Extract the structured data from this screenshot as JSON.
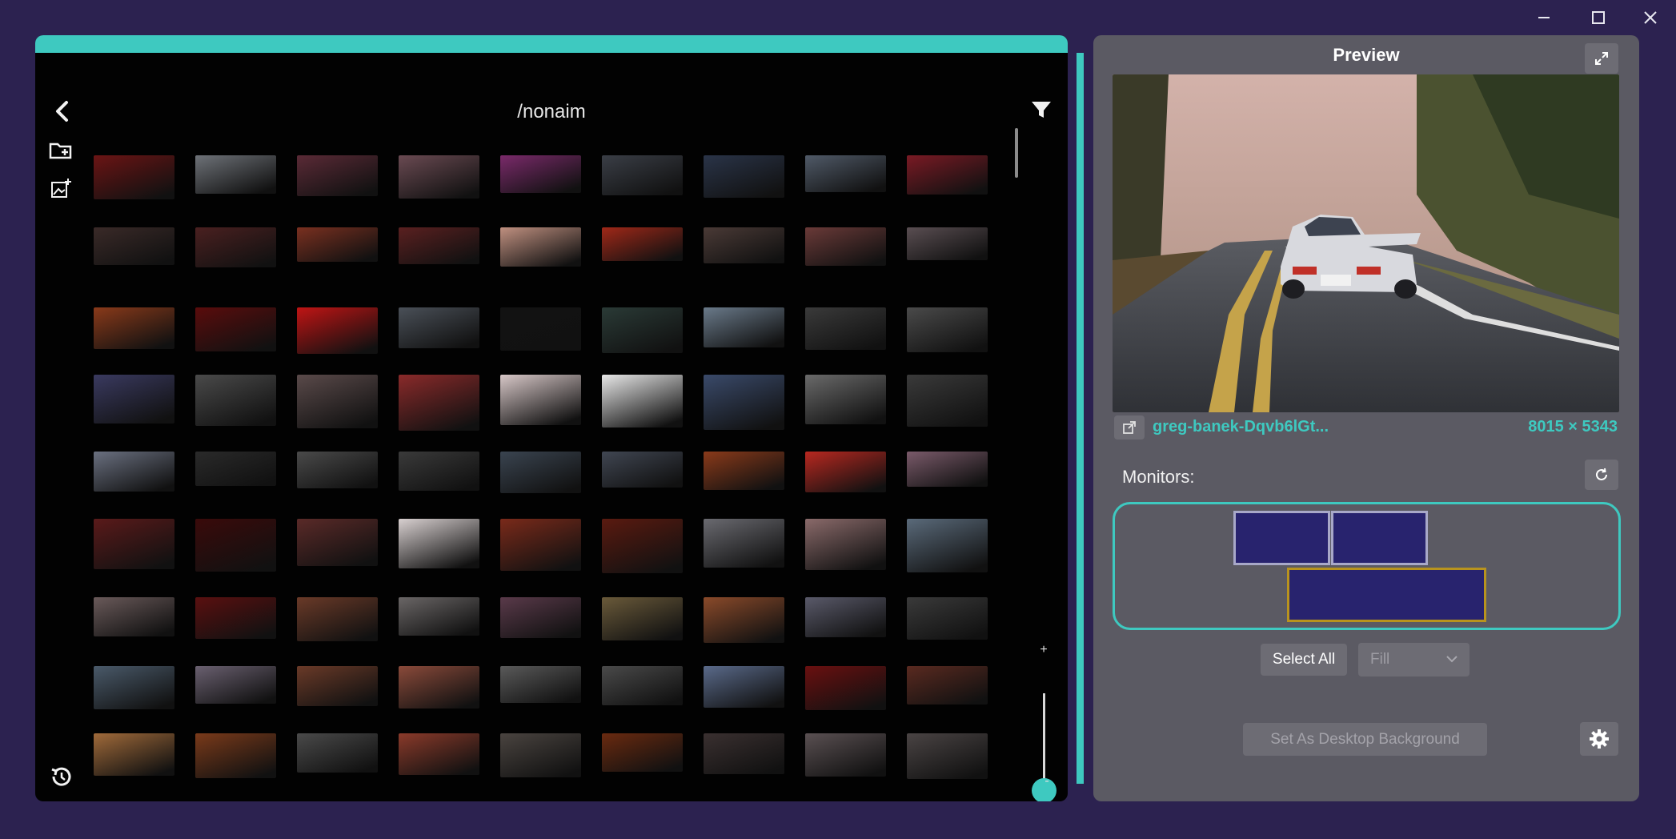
{
  "window": {
    "minimize_icon": "minimize-icon",
    "maximize_icon": "maximize-icon",
    "close_icon": "close-icon"
  },
  "browser": {
    "path": "/nonaim",
    "back_icon": "chevron-left-icon",
    "filter_icon": "filter-icon",
    "add_folder_icon": "folder-plus-icon",
    "add_image_icon": "image-plus-icon",
    "history_icon": "history-icon",
    "zoom_plus": "+",
    "zoom_minus": "-",
    "zoom_level": 0.15,
    "accent_color": "#3ec9c0"
  },
  "thumbnails": [
    [
      "#6b1414",
      "#6e7278",
      "#5a2a36",
      "#6a4a52",
      "#7a2a6a",
      "#3a3e46",
      "#2a3448",
      "#505a68",
      "#7a1a24"
    ],
    [
      "#3a2a28",
      "#4a2020",
      "#7a3020",
      "#5a2020",
      "#c09080",
      "#a02818",
      "#4a3a36",
      "#6a3a38",
      "#5a4e52"
    ],
    [
      "#8a3a1a",
      "#5a0c0c",
      "#c01414",
      "#4a5058",
      "#121212",
      "#2a3a36",
      "#6a7a8a",
      "#3a3a3a",
      "#4a4a4a"
    ],
    [
      "#3a3a60",
      "#4a4a4a",
      "#5a4a4a",
      "#8a2a2a",
      "#d8c8c8",
      "#e8e8e8",
      "#3a4a6a",
      "#6a6a6a",
      "#3a3a3a"
    ],
    [
      "#6a7080",
      "#2a2a2a",
      "#4a4a4a",
      "#3a3a3a",
      "#3a4450",
      "#404652",
      "#8a3a1a",
      "#b82820",
      "#7a5a6a"
    ],
    [
      "#5a1a1a",
      "#3a0a0a",
      "#5a2a28",
      "#d8d0d0",
      "#7a2a1a",
      "#5a1a10",
      "#6a6a70",
      "#8a6a6a",
      "#5a6a7a"
    ],
    [
      "#6a5a5a",
      "#5a1010",
      "#6a3a28",
      "#6a6666",
      "#5a3a4a",
      "#6a5a3a",
      "#8a4a2a",
      "#5a5a6a",
      "#3a3a3a"
    ],
    [
      "#4a5a6a",
      "#6a6070",
      "#6a3a28",
      "#8a4a3a",
      "#5a5a5a",
      "#4a4a4a",
      "#5a6a8a",
      "#6a1010",
      "#5a2a20"
    ],
    [
      "#a06a3a",
      "#7a3a1a",
      "#4a4a4a",
      "#8a3a2a",
      "#4a4440",
      "#6a2a10",
      "#3a3030",
      "#5a5052",
      "#4a4444"
    ],
    [
      "#6a5048",
      "#3a3a3a",
      "#2a3040",
      "#3a4858",
      "#c05a2a",
      "#6a4a3a",
      "#5a2a2a",
      "#9a4a2a",
      "#5a6a7a"
    ]
  ],
  "preview": {
    "title": "Preview",
    "expand_icon": "expand-icon",
    "open_external_icon": "external-link-icon",
    "file_name": "greg-banek-Dqvb6lGt...",
    "resolution": "8015 × 5343"
  },
  "monitors": {
    "label": "Monitors:",
    "refresh_icon": "refresh-icon",
    "list": [
      {
        "name": "monitor-1",
        "selected": false
      },
      {
        "name": "monitor-2",
        "selected": false
      },
      {
        "name": "monitor-3",
        "selected": true
      }
    ]
  },
  "controls": {
    "select_all_label": "Select All",
    "fill_mode": "Fill",
    "set_background_label": "Set As Desktop Background",
    "settings_icon": "gear-icon"
  }
}
